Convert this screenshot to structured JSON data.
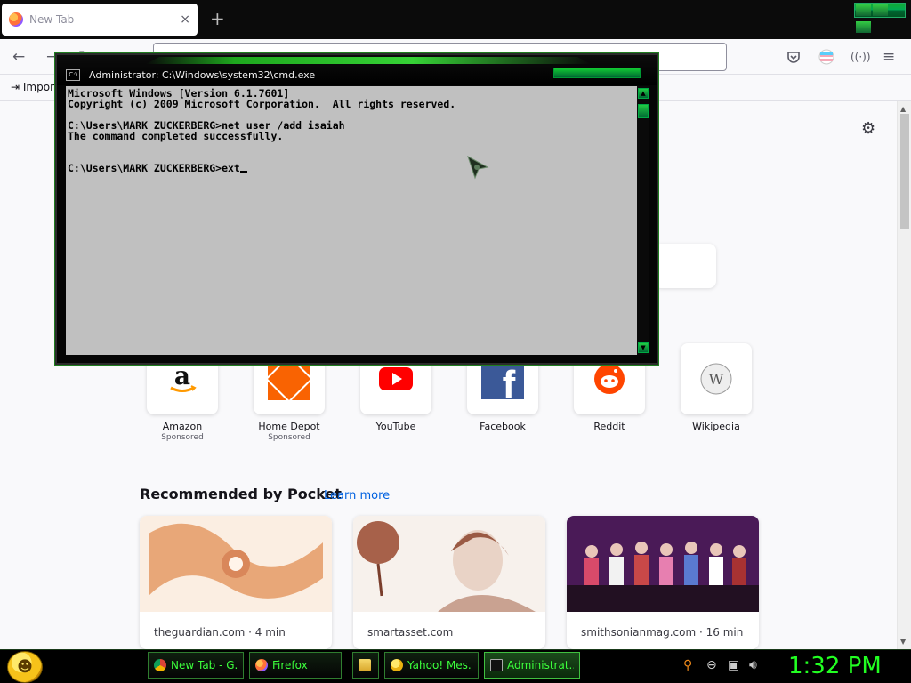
{
  "browser": {
    "tab_title": "New Tab",
    "tab_close": "×",
    "new_tab": "+",
    "bookmarks_import": "Impor",
    "nav_icons": [
      "back-icon",
      "forward-icon",
      "reload-icon",
      "pocket-icon",
      "account-icon",
      "extensions-icon",
      "menu-icon"
    ]
  },
  "newtab": {
    "settings_icon": "⚙",
    "shortcuts": [
      {
        "label": "Amazon",
        "sub": "Sponsored",
        "icon": "amazon-icon"
      },
      {
        "label": "Home Depot",
        "sub": "Sponsored",
        "icon": "homedepot-icon"
      },
      {
        "label": "YouTube",
        "sub": "",
        "icon": "youtube-icon"
      },
      {
        "label": "Facebook",
        "sub": "",
        "icon": "facebook-icon"
      },
      {
        "label": "Reddit",
        "sub": "",
        "icon": "reddit-icon"
      },
      {
        "label": "Wikipedia",
        "sub": "",
        "icon": "wikipedia-icon"
      }
    ],
    "pocket": {
      "title": "Recommended by Pocket",
      "learn_more": "Learn more",
      "cards": [
        {
          "source": "theguardian.com · 4 min"
        },
        {
          "source": "smartasset.com"
        },
        {
          "source": "smithsonianmag.com · 16 min"
        }
      ]
    }
  },
  "cmd": {
    "title": "Administrator: C:\\Windows\\system32\\cmd.exe",
    "icon_text": "C:\\",
    "lines": [
      "Microsoft Windows [Version 6.1.7601]",
      "Copyright (c) 2009 Microsoft Corporation.  All rights reserved.",
      "",
      "C:\\Users\\MARK ZUCKERBERG>net user /add isaiah",
      "The command completed successfully.",
      "",
      "",
      "C:\\Users\\MARK ZUCKERBERG>ext"
    ]
  },
  "taskbar": {
    "buttons": [
      {
        "label": "New Tab - G...",
        "icon": "chrome-icon"
      },
      {
        "label": "Firefox",
        "icon": "firefox-icon"
      },
      {
        "label": "",
        "icon": "folder-icon"
      },
      {
        "label": "Yahoo! Mes...",
        "icon": "yahoo-messenger-icon"
      },
      {
        "label": "Administrat...",
        "icon": "cmd-icon"
      }
    ],
    "clock": "1:32 PM"
  },
  "colors": {
    "accent_green": "#22ff22",
    "link_blue": "#0061e0"
  }
}
